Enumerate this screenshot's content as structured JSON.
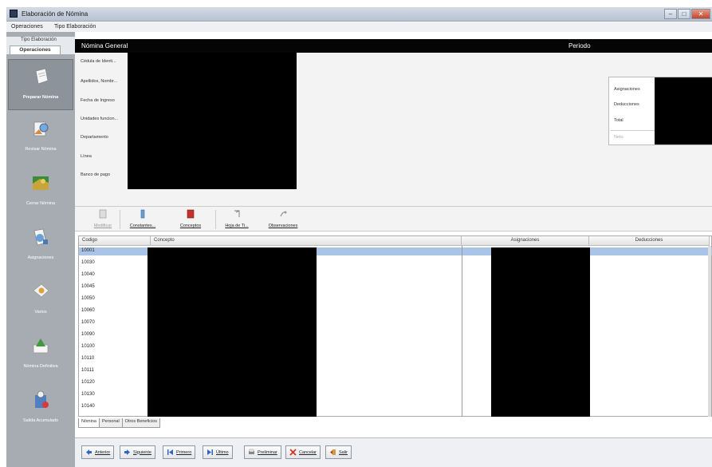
{
  "window": {
    "title": "Elaboración de Nómina"
  },
  "menu": [
    {
      "label": "Operaciones"
    },
    {
      "label": "Tipo Elaboración"
    }
  ],
  "sidebar": {
    "group_label": "Tipo Elaboración",
    "tab_label": "Operaciones",
    "items": [
      {
        "label": "Preparar Nómina",
        "icon": "prepare-payroll-icon",
        "active": true
      },
      {
        "label": "Revisar Nómina",
        "icon": "review-payroll-icon"
      },
      {
        "label": "Cerrar Nómina",
        "icon": "close-payroll-icon"
      },
      {
        "label": "Asignaciones",
        "icon": "assignments-icon"
      },
      {
        "label": "Varios",
        "icon": "misc-icon"
      },
      {
        "label": "Nómina Definitiva",
        "icon": "final-payroll-icon"
      },
      {
        "label": "Salida Acumulado",
        "icon": "output-accumulated-icon"
      }
    ]
  },
  "header": {
    "title": "Nómina General",
    "period_label": "Periodo"
  },
  "employee_fields": [
    "Cédula de Identi...",
    "Apellidos, Nombr...",
    "Fecha de Ingreso",
    "Unidades funcion...",
    "Departamento",
    "Línea",
    "Banco de pago"
  ],
  "summary": {
    "assignments_label": "Asignaciones",
    "deductions_label": "Deducciones",
    "total_label": "Total",
    "other_label": "Neto"
  },
  "toolbar": [
    {
      "label": "Modificar",
      "icon": "edit-icon",
      "disabled": true
    },
    {
      "label": "Constantes...",
      "icon": "constants-icon"
    },
    {
      "label": "Conceptos",
      "icon": "concepts-icon"
    },
    {
      "label": "Hoja de Ti...",
      "icon": "timesheet-icon"
    },
    {
      "label": "Observaciones",
      "icon": "observations-icon"
    }
  ],
  "grid": {
    "columns": {
      "code": "Codigo",
      "concept": "Concepto",
      "assignments": "Asignaciones",
      "deductions": "Deducciones"
    },
    "codes": [
      "10001",
      "10030",
      "10040",
      "10045",
      "10050",
      "10060",
      "10070",
      "10090",
      "10100",
      "10110",
      "10111",
      "10120",
      "10130",
      "10140"
    ]
  },
  "bottom_tabs": [
    {
      "label": "Nómina"
    },
    {
      "label": "Personal"
    },
    {
      "label": "Otros Beneficios"
    }
  ],
  "footer_buttons": [
    {
      "label": "Anterior",
      "icon": "arrow-left-icon"
    },
    {
      "label": "Siguiente",
      "icon": "arrow-right-icon"
    },
    {
      "label": "Primero",
      "icon": "first-icon"
    },
    {
      "label": "Último",
      "icon": "last-icon"
    },
    {
      "label": "Preliminar",
      "icon": "preview-icon"
    },
    {
      "label": "Cancelar",
      "icon": "cancel-icon"
    },
    {
      "label": "Salir",
      "icon": "exit-icon"
    }
  ],
  "colors": {
    "sidebar_bg": "#a7acb3",
    "header_bg": "#050505",
    "selection": "#a9c4e6",
    "mask": "#000000"
  }
}
